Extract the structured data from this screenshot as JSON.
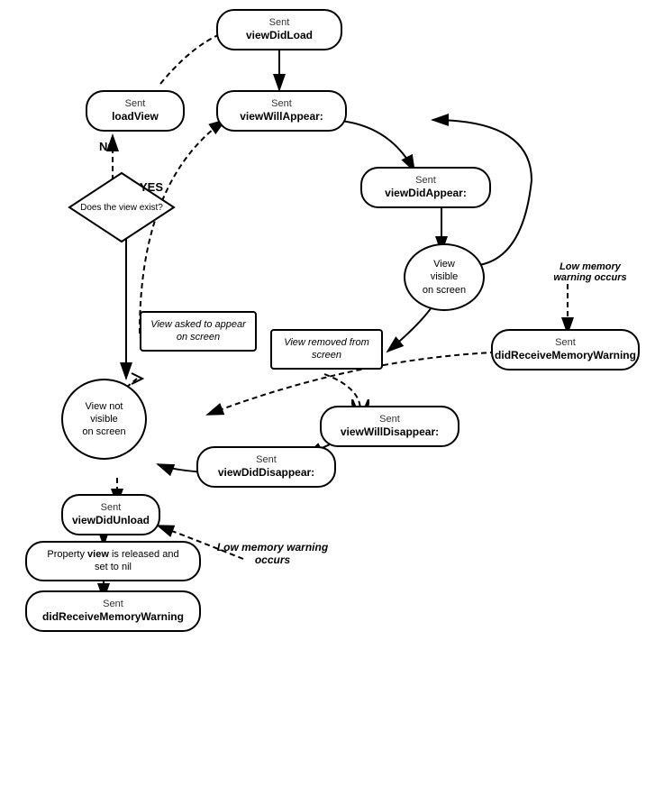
{
  "nodes": {
    "viewDidLoad": {
      "label_sent": "Sent",
      "label_main": "viewDidLoad"
    },
    "viewWillAppear": {
      "label_sent": "Sent",
      "label_main": "viewWillAppear:"
    },
    "viewDidAppear": {
      "label_sent": "Sent",
      "label_main": "viewDidAppear:"
    },
    "viewVisibleOnScreen": {
      "label_main": "View\nvisible\non screen"
    },
    "didReceiveMemoryWarning1": {
      "label_sent": "Sent",
      "label_main": "didReceiveMemoryWarning"
    },
    "viewWillDisappear": {
      "label_sent": "Sent",
      "label_main": "viewWillDisappear:"
    },
    "viewDidDisappear": {
      "label_sent": "Sent",
      "label_main": "viewDidDisappear:"
    },
    "viewNotVisible": {
      "label_main": "View not\nvisible\non screen"
    },
    "viewAskedToAppear": {
      "label_main": "View asked to\nappear on\nscreen"
    },
    "viewRemovedFromScreen": {
      "label_main": "View removed\nfrom\nscreen"
    },
    "loadView": {
      "label_sent": "Sent",
      "label_main": "loadView"
    },
    "doesViewExist": {
      "label_main": "Does the view\nexist?"
    },
    "viewDidUnload": {
      "label_sent": "Sent",
      "label_main": "viewDidUnload"
    },
    "propertyView": {
      "label_main": "Property view is released and\nset to nil"
    },
    "lowMemory1": {
      "label_main": "Low memory\nwarning occurs"
    },
    "lowMemory2": {
      "label_main": "Low memory\nwarning occurs"
    },
    "didReceiveMemoryWarning2": {
      "label_sent": "Sent",
      "label_main": "didReceiveMemoryWarning"
    },
    "yes_label": "YES",
    "no_label": "NO"
  }
}
